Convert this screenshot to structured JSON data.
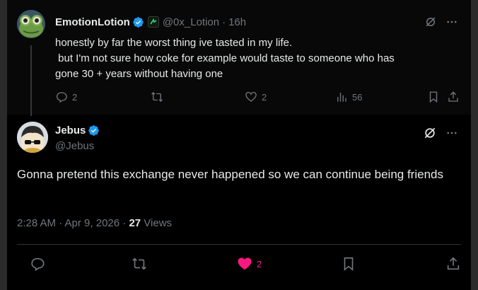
{
  "parent_tweet": {
    "author_name": "EmotionLotion",
    "handle": "@0x_Lotion",
    "separator": "·",
    "time": "16h",
    "text_lines": [
      "honestly by far the worst thing ive tasted in my life.",
      " but I'm not sure how coke for example would taste to someone who has",
      "gone 30 + years without having one"
    ],
    "actions": {
      "replies": "2",
      "likes": "2",
      "views": "56"
    }
  },
  "main_tweet": {
    "author_name": "Jebus",
    "handle": "@Jebus",
    "text": "Gonna pretend this exchange never happened so we can continue being friends",
    "timestamp": "2:28 AM · Apr 9, 2026 · ",
    "view_count": "27",
    "views_label": " Views",
    "actions": {
      "likes": "2"
    }
  },
  "colors": {
    "background": "#000000",
    "verified": "#1d9bf0",
    "like_active": "#f91880",
    "muted": "#71767b"
  }
}
